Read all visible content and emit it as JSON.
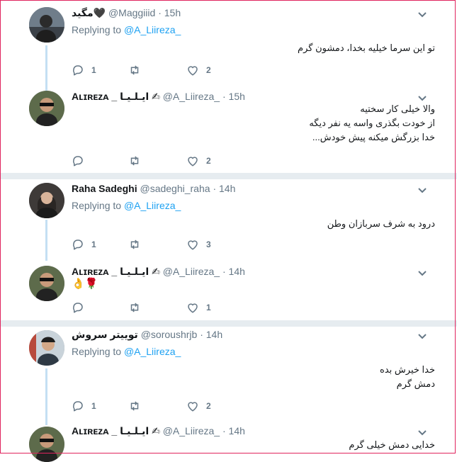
{
  "reply_prefix": "Replying to",
  "threads": [
    {
      "tweets": [
        {
          "name": "مگید🖤",
          "handle": "@Maggiiid",
          "time": "15h",
          "replying_to": "@A_Liireza_",
          "lines": [
            "تو این سرما خیلیه بخدا، دمشون گرم"
          ],
          "replies": "1",
          "retweets": "",
          "likes": "2"
        },
        {
          "name": "Aʟɪʀᴇᴢᴀ _ ایـلـیـا ✍",
          "handle": "@A_Liireza_",
          "time": "15h",
          "replying_to": "",
          "lines": [
            "والا خیلی کار سختیه",
            "از خودت بگذری واسه یه نفر دیگه",
            "خدا بزرگش میکنه پیش خودش..."
          ],
          "replies": "",
          "retweets": "",
          "likes": "2"
        }
      ]
    },
    {
      "tweets": [
        {
          "name": "Raha Sadeghi",
          "handle": "@sadeghi_raha",
          "time": "14h",
          "replying_to": "@A_Liireza_",
          "lines": [
            "درود به شرف سربازان وطن"
          ],
          "replies": "1",
          "retweets": "",
          "likes": "3"
        },
        {
          "name": "Aʟɪʀᴇᴢᴀ _ ایـلـیـا ✍",
          "handle": "@A_Liireza_",
          "time": "14h",
          "replying_to": "",
          "lines": [
            "👌🌹"
          ],
          "replies": "",
          "retweets": "",
          "likes": "1"
        }
      ]
    },
    {
      "tweets": [
        {
          "name": "تویيتر سروش",
          "handle": "@soroushrjb",
          "time": "14h",
          "replying_to": "@A_Liireza_",
          "lines": [
            "خدا خیرش بده",
            "دمش گرم"
          ],
          "replies": "1",
          "retweets": "",
          "likes": "2"
        },
        {
          "name": "Aʟɪʀᴇᴢᴀ _ ایـلـیـا ✍",
          "handle": "@A_Liireza_",
          "time": "14h",
          "replying_to": "",
          "lines": [
            "خدایی دمش خیلی گرم"
          ],
          "replies": "",
          "retweets": "",
          "likes": ""
        }
      ]
    }
  ]
}
